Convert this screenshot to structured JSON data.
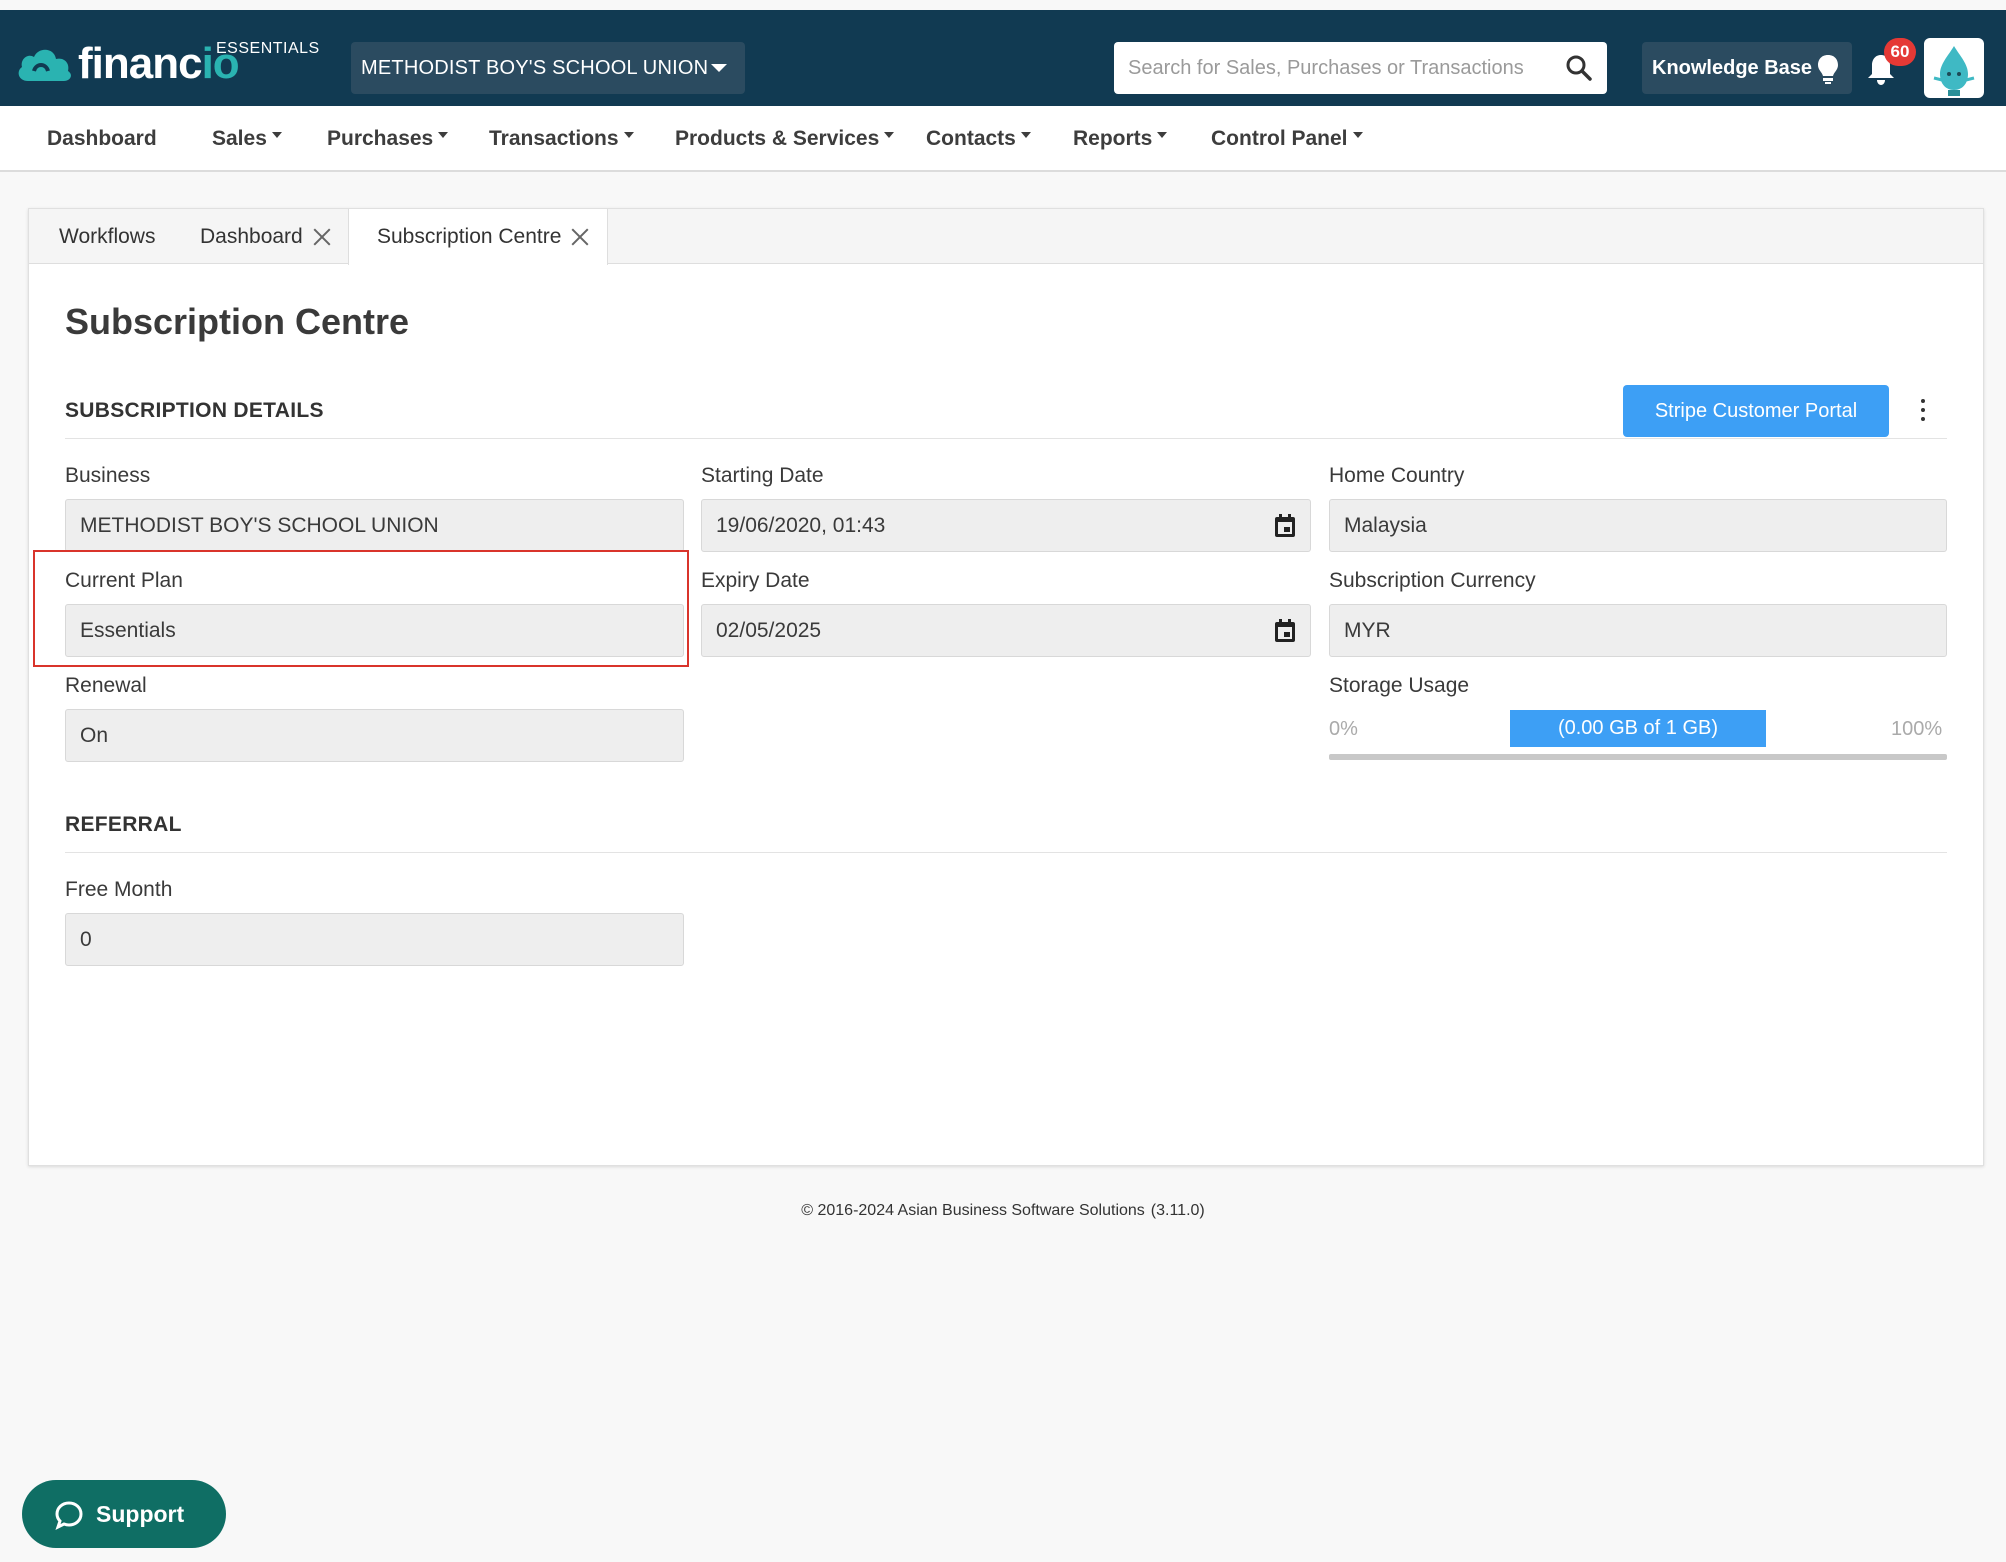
{
  "header": {
    "logo_text_a": "financ",
    "logo_text_b": "io",
    "edition": "ESSENTIALS",
    "business_selector": "METHODIST BOY'S SCHOOL UNION",
    "search_placeholder": "Search for Sales, Purchases or Transactions",
    "knowledge_base_label": "Knowledge Base",
    "notification_count": "60"
  },
  "nav": {
    "items": [
      {
        "label": "Dashboard",
        "dropdown": false
      },
      {
        "label": "Sales",
        "dropdown": true
      },
      {
        "label": "Purchases",
        "dropdown": true
      },
      {
        "label": "Transactions",
        "dropdown": true
      },
      {
        "label": "Products & Services",
        "dropdown": true
      },
      {
        "label": "Contacts",
        "dropdown": true
      },
      {
        "label": "Reports",
        "dropdown": true
      },
      {
        "label": "Control Panel",
        "dropdown": true
      }
    ]
  },
  "tabs": [
    {
      "label": "Workflows",
      "closable": false
    },
    {
      "label": "Dashboard",
      "closable": true
    },
    {
      "label": "Subscription Centre",
      "closable": true,
      "active": true
    }
  ],
  "page": {
    "title": "Subscription Centre",
    "subscription_section": "SUBSCRIPTION DETAILS",
    "stripe_button": "Stripe Customer Portal",
    "fields": {
      "business": {
        "label": "Business",
        "value": "METHODIST BOY'S SCHOOL UNION"
      },
      "starting_date": {
        "label": "Starting Date",
        "value": "19/06/2020, 01:43"
      },
      "home_country": {
        "label": "Home Country",
        "value": "Malaysia"
      },
      "current_plan": {
        "label": "Current Plan",
        "value": "Essentials"
      },
      "expiry_date": {
        "label": "Expiry Date",
        "value": "02/05/2025"
      },
      "subscription_currency": {
        "label": "Subscription Currency",
        "value": "MYR"
      },
      "renewal": {
        "label": "Renewal",
        "value": "On"
      }
    },
    "storage": {
      "label": "Storage Usage",
      "min_label": "0%",
      "max_label": "100%",
      "usage_text": "(0.00 GB of 1 GB)",
      "used_fraction": 0.0
    },
    "referral_section": "REFERRAL",
    "free_month": {
      "label": "Free Month",
      "value": "0"
    }
  },
  "footer": {
    "copyright": "© 2016-2024 Asian Business Software Solutions",
    "version": "(3.11.0)"
  },
  "support_button": "Support",
  "colors": {
    "header_bg": "#113a52",
    "accent_blue": "#3d9ff5",
    "brand_teal": "#2ab3b1",
    "support_green": "#0f6e64",
    "highlight_red": "#d9342b",
    "badge_red": "#e53935"
  }
}
